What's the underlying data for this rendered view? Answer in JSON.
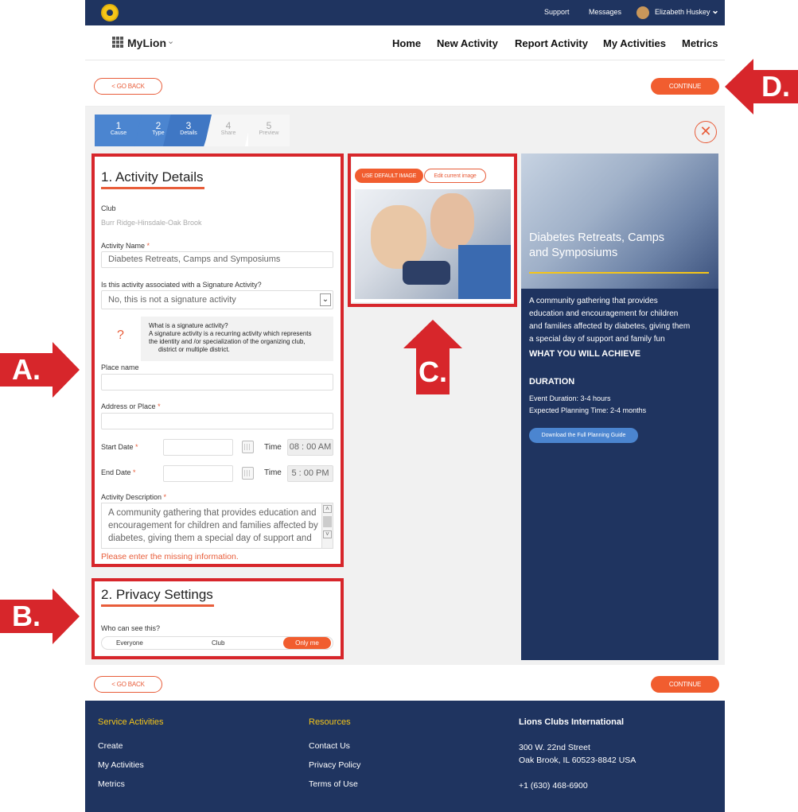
{
  "topbar": {
    "support": "Support",
    "messages": "Messages",
    "user_name": "Elizabeth Huskey"
  },
  "nav": {
    "brand": "MyLion",
    "links": [
      "Home",
      "New Activity",
      "Report Activity",
      "My Activities",
      "Metrics"
    ]
  },
  "actions": {
    "go_back": "< GO BACK",
    "continue": "CONTINUE"
  },
  "steps": [
    {
      "num": "1",
      "label": "Cause"
    },
    {
      "num": "2",
      "label": "Type"
    },
    {
      "num": "3",
      "label": "Details"
    },
    {
      "num": "4",
      "label": "Share"
    },
    {
      "num": "5",
      "label": "Preview"
    }
  ],
  "details": {
    "title": "1. Activity Details",
    "club_label": "Club",
    "club_value": "Burr Ridge-Hinsdale-Oak Brook",
    "activity_name_label": "Activity Name",
    "activity_name_value": "Diabetes Retreats, Camps and Symposiums",
    "signature_label": "Is this activity associated with a Signature Activity?",
    "signature_value": "No, this is not a signature activity",
    "hint_title": "What is a signature activity?",
    "hint_line1": "A signature activity is a recurring activity which represents",
    "hint_line2": "the identity and /or specialization of the organizing club,",
    "hint_line3": "district or multiple district.",
    "place_label": "Place name",
    "address_label": "Address or Place",
    "start_label": "Start Date",
    "end_label": "End Date",
    "time_label": "Time",
    "start_time": "08 : 00 AM",
    "end_time": "5 : 00 PM",
    "desc_label": "Activity Description",
    "desc_line1": "A community gathering that provides education and",
    "desc_line2": "encouragement for children and families affected by",
    "desc_line3": "diabetes, giving them a special day of support and",
    "error": "Please enter the missing information.",
    "req_mark": "*"
  },
  "privacy": {
    "title": "2. Privacy Settings",
    "question": "Who can see this?",
    "options": [
      "Everyone",
      "Club",
      "Only me"
    ]
  },
  "image": {
    "use_default": "USE DEFAULT IMAGE",
    "edit": "Edit current image"
  },
  "hero": {
    "title_line1": "Diabetes Retreats, Camps",
    "title_line2": "and Symposiums",
    "p1": "A community gathering that provides",
    "p2": "education and encouragement for children",
    "p3": "and families affected by diabetes, giving them",
    "p4": "a special day of support and family fun",
    "achieve": "WHAT YOU WILL ACHIEVE",
    "duration": "DURATION",
    "event_duration": "Event Duration: 3-4 hours",
    "planning_time": "Expected Planning Time: 2-4 months",
    "download": "Download the Full Planning Guide"
  },
  "footer": {
    "col1_title": "Service Activities",
    "col1": [
      "Create",
      "My Activities",
      "Metrics"
    ],
    "col2_title": "Resources",
    "col2": [
      "Contact Us",
      "Privacy Policy",
      "Terms of Use"
    ],
    "col3_title": "Lions Clubs International",
    "addr1": "300 W. 22nd Street",
    "addr2": "Oak Brook, IL 60523-8842 USA",
    "phone": "+1 (630) 468-6900"
  },
  "callouts": {
    "a": "A.",
    "b": "B.",
    "c": "C.",
    "d": "D."
  },
  "colors": {
    "navy": "#1f3460",
    "accent": "#f15d2f",
    "gold": "#f5c518",
    "callout_red": "#d7262b",
    "step_blue": "#4b85d0"
  }
}
